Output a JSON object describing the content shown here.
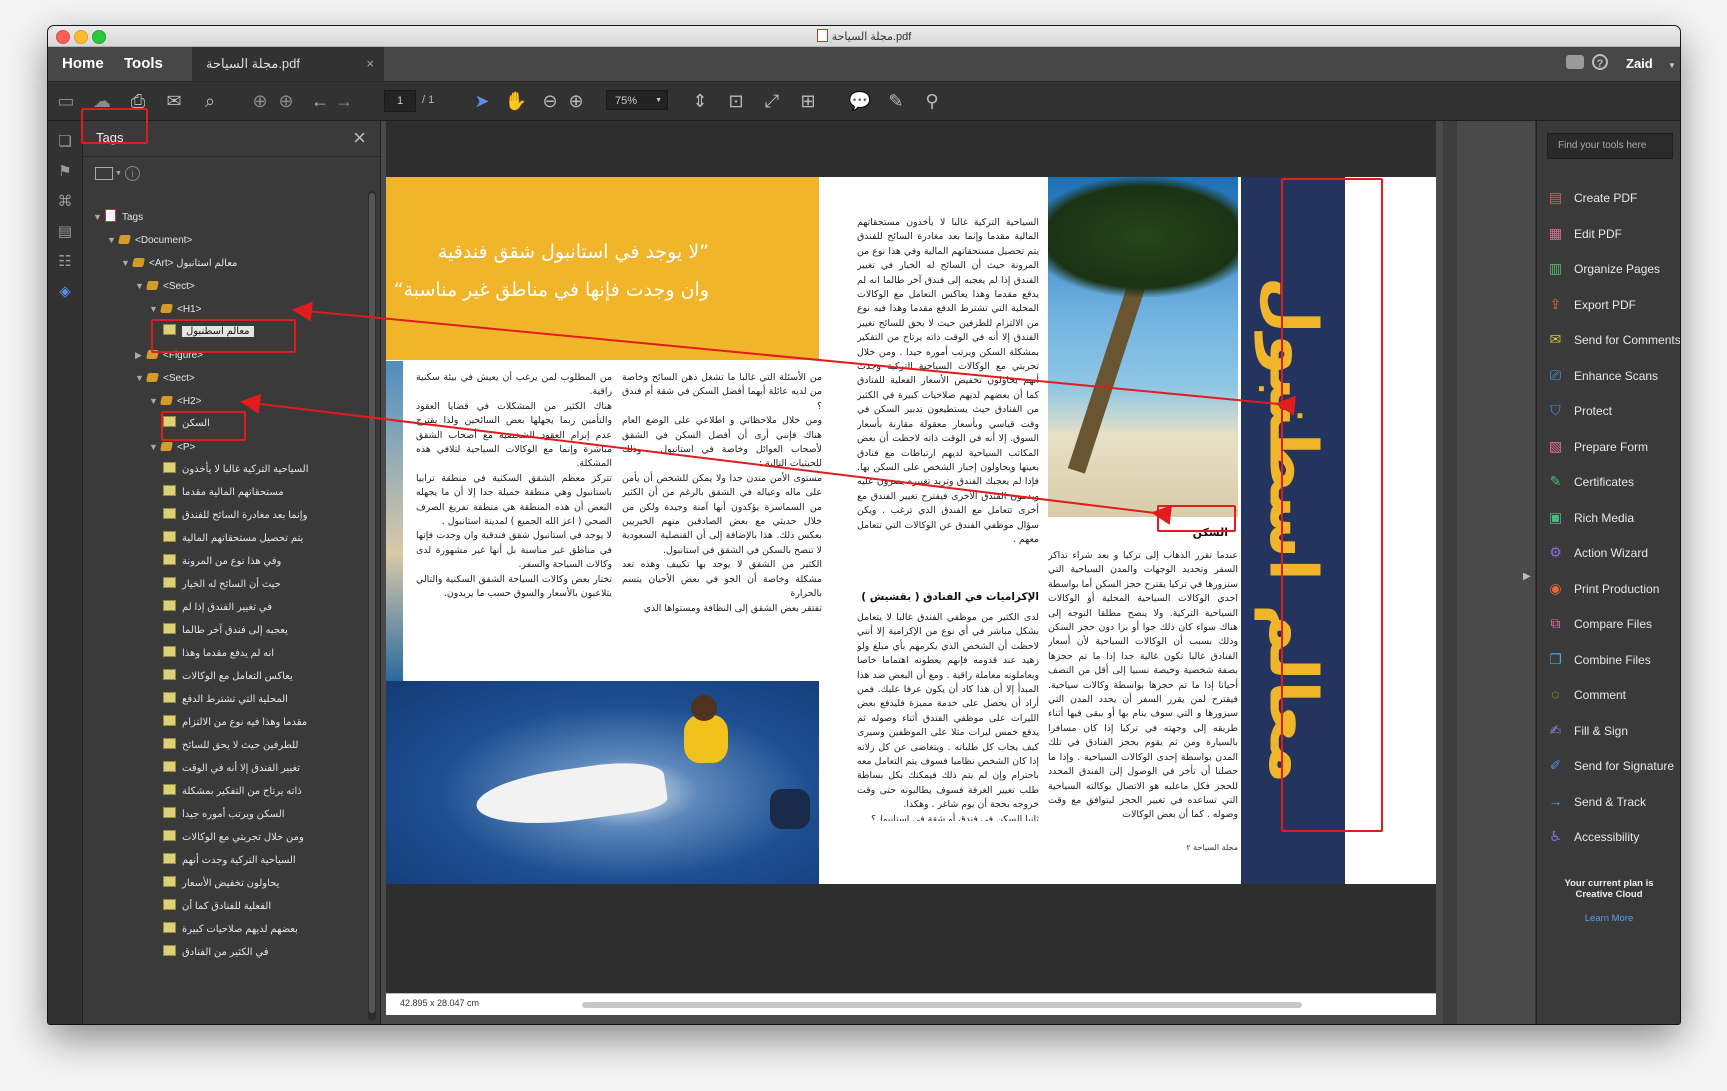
{
  "window": {
    "title": "مجلة السياحة.pdf"
  },
  "menubar": {
    "home": "Home",
    "tools": "Tools",
    "doc_tab": "مجلة السياحة.pdf",
    "close": "×",
    "user": "Zaid"
  },
  "toolbar": {
    "page_current": "1",
    "page_total": "/ 1",
    "zoom": "75%"
  },
  "tags_panel": {
    "title": "Tags",
    "close": "×",
    "items": [
      {
        "label": "Tags",
        "depth": 0,
        "kind": "root",
        "expanded": true
      },
      {
        "label": "<Document>",
        "depth": 1,
        "kind": "tag",
        "expanded": true
      },
      {
        "label": "<Art> معالم استانبول",
        "depth": 2,
        "kind": "tag",
        "expanded": true
      },
      {
        "label": "<Sect>",
        "depth": 3,
        "kind": "tag",
        "expanded": true
      },
      {
        "label": "<H1>",
        "depth": 4,
        "kind": "tag",
        "expanded": true
      },
      {
        "label": "معالم اسطنبول",
        "depth": 5,
        "kind": "text",
        "selected": true
      },
      {
        "label": "<Figure>",
        "depth": 3,
        "kind": "tag",
        "expanded": false
      },
      {
        "label": "<Sect>",
        "depth": 3,
        "kind": "tag",
        "expanded": true
      },
      {
        "label": "<H2>",
        "depth": 4,
        "kind": "tag",
        "expanded": true
      },
      {
        "label": "السكن",
        "depth": 5,
        "kind": "text"
      },
      {
        "label": "<P>",
        "depth": 4,
        "kind": "tag",
        "expanded": true
      },
      {
        "label": "السياحية التركية غالبا لا يأخذون",
        "depth": 5,
        "kind": "text"
      },
      {
        "label": "مستحقاتهم المالية مقدما",
        "depth": 5,
        "kind": "text"
      },
      {
        "label": "وإنما بعد مغادرة السائح للفندق",
        "depth": 5,
        "kind": "text"
      },
      {
        "label": "يتم تحصيل مستحقاتهم المالية",
        "depth": 5,
        "kind": "text"
      },
      {
        "label": "وفي هذا نوع من المرونة",
        "depth": 5,
        "kind": "text"
      },
      {
        "label": "حيث أن السائح له الخيار",
        "depth": 5,
        "kind": "text"
      },
      {
        "label": "في تغيير الفندق إذا لم",
        "depth": 5,
        "kind": "text"
      },
      {
        "label": "يعجبه إلى فندق آخر طالما",
        "depth": 5,
        "kind": "text"
      },
      {
        "label": "انه لم يدفع مقدما وهذا",
        "depth": 5,
        "kind": "text"
      },
      {
        "label": "يعاكس التعامل مع الوكالات",
        "depth": 5,
        "kind": "text"
      },
      {
        "label": "المحلية التي تشترط الدفع",
        "depth": 5,
        "kind": "text"
      },
      {
        "label": "مقدما وهذا فيه نوع من الالتزام",
        "depth": 5,
        "kind": "text"
      },
      {
        "label": "للطرفين حيث لا يحق للسائح",
        "depth": 5,
        "kind": "text"
      },
      {
        "label": "تغيير الفندق إلا أنه في الوقت",
        "depth": 5,
        "kind": "text"
      },
      {
        "label": "ذاته يرتاح من التفكير بمشكلة",
        "depth": 5,
        "kind": "text"
      },
      {
        "label": "السكن ويرتب أموره جيدا",
        "depth": 5,
        "kind": "text"
      },
      {
        "label": "ومن خلال تجربتي مع الوكالات",
        "depth": 5,
        "kind": "text"
      },
      {
        "label": "السياحية التركية وجدت أنهم",
        "depth": 5,
        "kind": "text"
      },
      {
        "label": "يحاولون تخفيض الأسعار",
        "depth": 5,
        "kind": "text"
      },
      {
        "label": "الفعلية للفنادق كما أن",
        "depth": 5,
        "kind": "text"
      },
      {
        "label": "بعضهم لديهم صلاحيات كبيرة",
        "depth": 5,
        "kind": "text"
      },
      {
        "label": "في الكثير من الفنادق",
        "depth": 5,
        "kind": "text"
      }
    ]
  },
  "document": {
    "quote_line1": "”لا يوجد في استانبول شقق فندقية",
    "quote_line2": "وان وجدت فإنها في مناطق غير مناسبة“",
    "vertical_title": "معالم اسطنبول",
    "subheading": "السكن",
    "subheading2": "الإكراميات في الفنادق ( بقشيش )",
    "footer": "مجلة السياحة   ٢",
    "page_size": "42.895 x 28.047 cm",
    "col1_text": "من المطلوب لمن يرغب أن يعيش في بيئة سكنية راقية.\nهناك الكثير من المشكلات في قضايا العقود والتأمين ربما يجهلها بعض السائحين ولذا يقترح عدم إبرام العقود الشخصية مع أصحاب الشقق مباشرة وإنما مع الوكالات السياحية لتلافي هذه المشكلة.\nتتركز معظم الشقق السكنية في منطقة ترابيا باستانبول وهي منطقة جميلة جدا إلا أن ما يجهله البعض أن هذه المنطقة هي منطقة تفريغ الصرف الصحي ( اعز الله الجميع ) لمدينة استانبول .\nلا يوجد في استانبول شقق فندقية وان وجدت فإنها في مناطق غير مناسبة بل أنها غير مشهورة لدى وكالات السياحة والسفر.\nتختار بعض وكالات السياحة الشقق السكنية والتالي يتلاعبون بالأسعار والسوق حسب ما يريدون.",
    "col2_text": "من الأسئلة التي غالبا ما تشغل ذهن السائح وخاصة من لديه عائلة أيهما أفضل السكن في شقة أم فندق ؟\nومن خلال ملاحظاتي و اطلاعي على الوضع العام هناك فإنني أرى أن أفضل السكن في الشقق لأصحاب العوائل وخاصة في استانبول . وذلك للحيثيات التالية :\nمستوى الأمن متدن جدا ولا يمكن للشخص أن يأمن على ماله وعياله في الشقق بالرغم من أن الكثير من السماسرة يؤكدون أنها آمنة وجيدة ولكن من خلال حديثي مع بعض الصادقين منهم الخيريين بعكس ذلك. هذا بالإضافة إلى أن القنصلية السعودية لا تنصح بالسكن في الشقق في استانبول.\nالكثير من الشقق لا يوجد بها تكييف وهذه تعد مشكلة وخاصة أن الجو في بعض الأحيان يتسم بالحرارة\nتفتقر بعض الشقق إلى النظافة ومستواها الذي",
    "col3_text": "السياحية التركية غالبا لا يأخذون مستحقاتهم المالية مقدما وإنما بعد مغادرة السائح للفندق يتم تحصيل مستحقاتهم المالية وفي هذا نوع من المرونة حيث أن السائح له الخيار في تغيير الفندق إذا لم يعجبه إلى فندق آخر طالما انه لم يدفع مقدما وهذا يعاكس التعامل مع الوكالات المحلية التي تشترط الدفع مقدما وهذا فيه نوع من الالتزام للطرفين حيث لا يحق للسائح تغيير الفندق إلا أنه في الوقت ذاته يرتاح من التفكير بمشكلة السكن ويرتب أموره جيدا . ومن خلال تجربتي مع الوكالات السياحية التركية وجدت أنهم يحاولون تخفيض الأسعار الفعلية للفنادق كما أن بعضهم لديهم صلاحيات كبيرة في الكثير من الفنادق حيث يستطيعون تدبير السكن في وقت قياسي وبأسعار معقولة مقارنة بأسعار السوق. إلا أنه في الوقت ذاته لاحظت أن بعض المكاتب السياحية لديهم ارتباطات مع فنادق بعينها ويحاولون إجبار الشخص على السكن بها. فإذا لم يعجبك الفندق وتريد تغييره يصرون عليه ويدمون الفندق الأخرى فيفترح تغيير الفندق مع أخرى تتعامل مع الفندق الذي ترغب . ويكن سؤال موظفي الفندق عن الوكالات التي تتعامل معهم .",
    "col4_text": "لدى الكثير من موظفي الفندق غالبا لا يتعامل بشكل مباشر في أي نوع من الإكرامية إلا أنني لاحظت أن الشخص الذي يكرمهم بأي مبلغ ولو زهيد عند قدومه فإنهم يعطونه اهتماما خاصا ويعاملونه معاملة راقية . ومع أن البعض ضد هذا المبدأ إلا أن هذا كاد أن يكون عرفا عليك. فمن أراد أن يحصل على خدمة مميزة فليدفع بعض الليرات على موظفي الفندق أثناء وصوله ثم يدفع خمس ليرات مثلا على الموظفين وسيرى كيف يجاب كل طلباته . ويتغاضى عن كل زلاته إذا كان الشخص نظاميا فسوف يتم التعامل معه باحترام وإن لم يتم ذلك فيمكنك بكل بساطة طلب تغيير الغرفة فسوف يطالبونه حتى وقت خروجه بحجة أن يوم شاغر . وهكذا.\nثانيا السكن في فندق أو شقة في استانبول؟",
    "col5_text": "عندما تقرر الذهاب إلى تركيا و بعد شراء تذاكر السفر وتحديد الوجهات والمدن السياحية التي ستزورها في تركيا يقترح حجز السكن أما بواسطة احدي الوكالات السياحية المحلية أو الوكالات السياحية التركية. ولا ينصح مطلقا التوجه إلى هناك سواء كان ذلك جوا أو برا دون حجز السكن وذلك بسبب أن الوكالات السياحية لأن أسعار الفنادق غالبا تكون غالية جدا إذا ما تم حجزها بصفة شخصية وخيصة نسبيا إلى أقل من النصف أحيانا إذا ما تم حجزها بواسطة وكالات سياحية. فيقترح لمن يقرر السفر أن يحدد المدن التي سيزورها و التي سوف ينام بها أو يبقى فيها أثناء طريقه إلى وجهته في تركيا إذا كان مسافرا بالسيارة ومن ثم يقوم بحجز الفنادق في تلك المدن بواسطة إحدى الوكالات السياحية . وإذا ما حصلنا أن تأخر في الوصول إلى الفندق المحدد للحجز فكل ماعليه هو الاتصال بوكالته السياحية التي تساعده في تغيير الحجز ليتوافق مع وقت وصوله . كما أن بعض الوكالات"
  },
  "tools_panel": {
    "search_placeholder": "Find your tools here",
    "tools": [
      {
        "label": "Create PDF",
        "icon": "create-pdf-icon",
        "color": "#e85a5a"
      },
      {
        "label": "Edit PDF",
        "icon": "edit-pdf-icon",
        "color": "#e8669a"
      },
      {
        "label": "Organize Pages",
        "icon": "organize-pages-icon",
        "color": "#5ab866"
      },
      {
        "label": "Export PDF",
        "icon": "export-pdf-icon",
        "color": "#e8663c"
      },
      {
        "label": "Send for Comments",
        "icon": "send-comments-icon",
        "color": "#e8c23c"
      },
      {
        "label": "Enhance Scans",
        "icon": "enhance-scans-icon",
        "color": "#48a8e0"
      },
      {
        "label": "Protect",
        "icon": "protect-icon",
        "color": "#4a8fe0"
      },
      {
        "label": "Prepare Form",
        "icon": "prepare-form-icon",
        "color": "#e86aa6"
      },
      {
        "label": "Certificates",
        "icon": "certificates-icon",
        "color": "#4ab87a"
      },
      {
        "label": "Rich Media",
        "icon": "rich-media-icon",
        "color": "#4ab87a"
      },
      {
        "label": "Action Wizard",
        "icon": "action-wizard-icon",
        "color": "#8a6ae0"
      },
      {
        "label": "Print Production",
        "icon": "print-production-icon",
        "color": "#e8663c"
      },
      {
        "label": "Compare Files",
        "icon": "compare-files-icon",
        "color": "#e866a6"
      },
      {
        "label": "Combine Files",
        "icon": "combine-files-icon",
        "color": "#48a8e0"
      },
      {
        "label": "Comment",
        "icon": "comment-icon",
        "color": "#e8c23c"
      },
      {
        "label": "Fill & Sign",
        "icon": "fill-sign-icon",
        "color": "#8a8ae0"
      },
      {
        "label": "Send for Signature",
        "icon": "send-signature-icon",
        "color": "#4a8fe0"
      },
      {
        "label": "Send & Track",
        "icon": "send-track-icon",
        "color": "#48a8e0"
      },
      {
        "label": "Accessibility",
        "icon": "accessibility-icon",
        "color": "#8a6ae0"
      }
    ],
    "plan_text": "Your current plan is Creative Cloud",
    "learn_more": "Learn More"
  }
}
